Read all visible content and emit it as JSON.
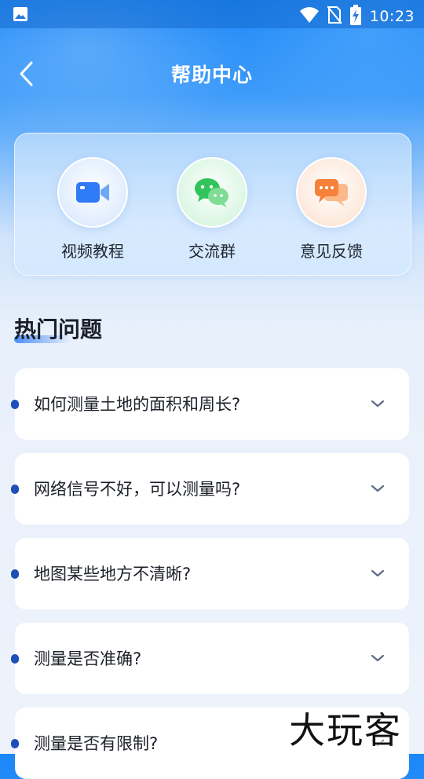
{
  "status_bar": {
    "time": "10:23",
    "icons": [
      "image-icon",
      "wifi-icon",
      "no-sim-icon",
      "battery-charging-icon"
    ]
  },
  "header": {
    "title": "帮助中心",
    "back_icon": "chevron-left-icon"
  },
  "shortcuts": [
    {
      "label": "视频教程",
      "icon": "video-camera-icon",
      "color": "#2f7af5"
    },
    {
      "label": "交流群",
      "icon": "wechat-icon",
      "color": "#31c45a"
    },
    {
      "label": "意见反馈",
      "icon": "chat-bubbles-icon",
      "color": "#f5813a"
    }
  ],
  "faq": {
    "title": "热门问题",
    "items": [
      {
        "question": "如何测量土地的面积和周长?"
      },
      {
        "question": "网络信号不好，可以测量吗?"
      },
      {
        "question": "地图某些地方不清晰?"
      },
      {
        "question": "测量是否准确?"
      },
      {
        "question": "测量是否有限制?"
      }
    ]
  },
  "watermark": "大玩客"
}
